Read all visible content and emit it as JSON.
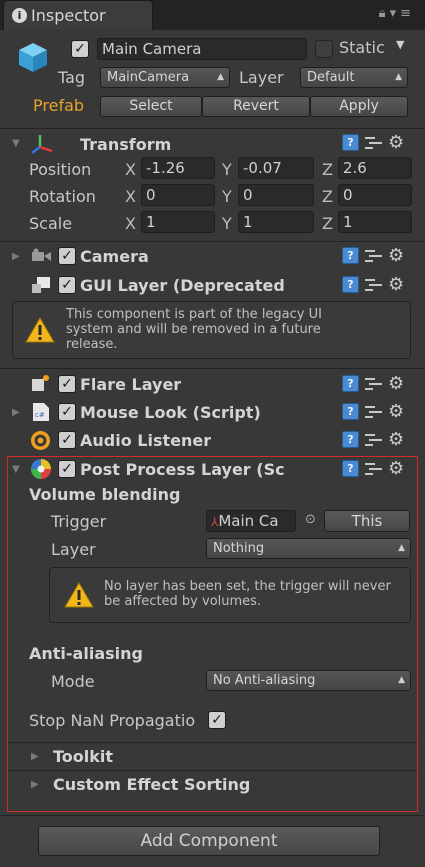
{
  "tab": {
    "title": "Inspector"
  },
  "header": {
    "object_name": "Main Camera",
    "static_label": "Static",
    "tag_label": "Tag",
    "tag_value": "MainCamera",
    "layer_label": "Layer",
    "layer_value": "Default",
    "prefab_label": "Prefab",
    "select_label": "Select",
    "revert_label": "Revert",
    "apply_label": "Apply",
    "prefab_color": "#e6a32b"
  },
  "transform": {
    "title": "Transform",
    "rows": [
      {
        "label": "Position",
        "x": "-1.26",
        "y": "-0.07",
        "z": "2.6"
      },
      {
        "label": "Rotation",
        "x": "0",
        "y": "0",
        "z": "0"
      },
      {
        "label": "Scale",
        "x": "1",
        "y": "1",
        "z": "1"
      }
    ],
    "axis_x": "X",
    "axis_y": "Y",
    "axis_z": "Z"
  },
  "components": {
    "camera": "Camera",
    "gui_layer": "GUI Layer (Deprecated",
    "gui_warning": "This component is part of the legacy UI system and will be removed in a future release.",
    "flare_layer": "Flare Layer",
    "mouse_look": "Mouse Look (Script)",
    "audio_listener": "Audio Listener",
    "post_process": "Post Process Layer (Sc"
  },
  "post_process": {
    "volume_blending": "Volume blending",
    "trigger_label": "Trigger",
    "trigger_value": "Main Ca",
    "this_button": "This",
    "layer_label": "Layer",
    "layer_value": "Nothing",
    "layer_warning": "No layer has been set, the trigger will never be affected by volumes.",
    "anti_aliasing": "Anti-aliasing",
    "mode_label": "Mode",
    "mode_value": "No Anti-aliasing",
    "stop_nan": "Stop NaN Propagatio",
    "toolkit": "Toolkit",
    "custom_sorting": "Custom Effect Sorting"
  },
  "footer": {
    "add_component": "Add Component"
  },
  "icons": [
    "info-icon",
    "lock-icon",
    "menu-icon",
    "cube-icon",
    "transform-icon",
    "camera-icon",
    "gui-layer-icon",
    "warning-icon",
    "flare-icon",
    "script-icon",
    "audio-icon",
    "post-process-icon",
    "help-icon",
    "preset-icon",
    "gear-icon"
  ]
}
